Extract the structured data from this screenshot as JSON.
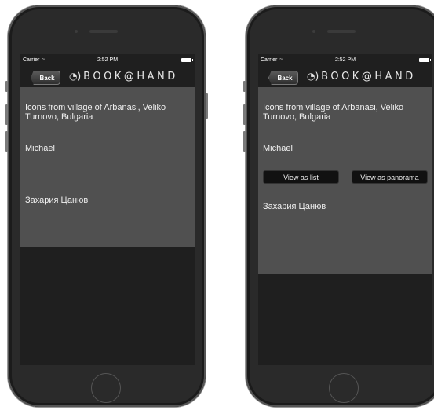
{
  "screens": [
    {
      "status_bar": {
        "carrier": "Carrier",
        "time": "2:52 PM"
      },
      "nav_bar": {
        "back_label": "Back",
        "logo_text": "BOOK@HAND"
      },
      "items": [
        {
          "text": "Icons from village of Arbanasi, Veliko Turnovo, Bulgaria"
        },
        {
          "text": "Michael"
        },
        {
          "text": "Захария Цанюв"
        }
      ]
    },
    {
      "status_bar": {
        "carrier": "Carrier",
        "time": "2:52 PM"
      },
      "nav_bar": {
        "back_label": "Back",
        "logo_text": "BOOK@HAND"
      },
      "items": [
        {
          "text": "Icons from village of Arbanasi, Veliko Turnovo, Bulgaria"
        },
        {
          "text": "Michael"
        },
        {
          "text": "Захария Цанюв"
        }
      ],
      "actions": {
        "view_list_label": "View as list",
        "view_panorama_label": "View as panorama"
      }
    }
  ],
  "colors": {
    "content_bg": "#505050",
    "screen_bg": "#1f1f1f",
    "phone_body": "#2a2a2a"
  }
}
